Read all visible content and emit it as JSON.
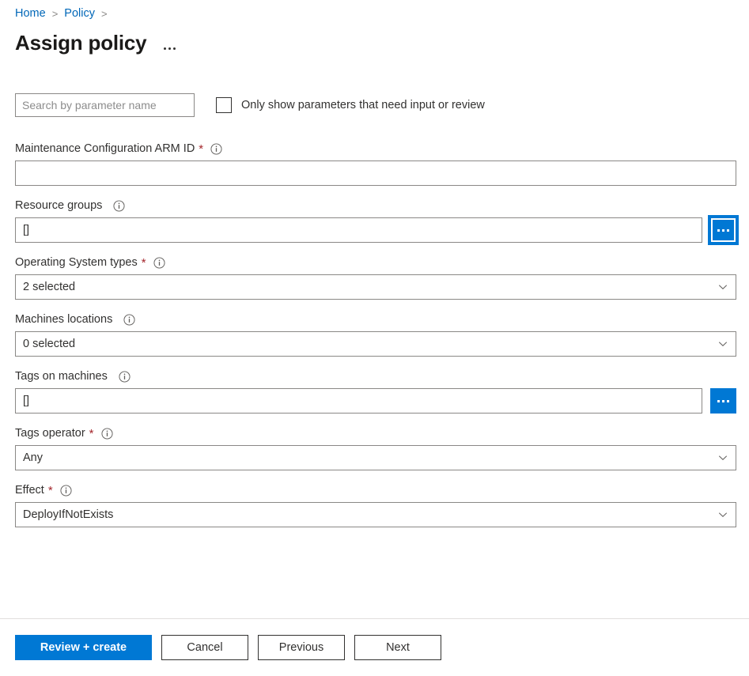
{
  "breadcrumb": {
    "items": [
      {
        "label": "Home"
      },
      {
        "label": "Policy"
      }
    ],
    "separator": ">"
  },
  "header": {
    "title": "Assign policy",
    "more_menu_name": "More commands"
  },
  "toolbar": {
    "search_placeholder": "Search by parameter name",
    "search_value": "",
    "checkbox_label": "Only show parameters that need input or review",
    "checkbox_checked": false
  },
  "form": {
    "fields": [
      {
        "label": "Maintenance Configuration ARM ID",
        "required_mark": "*",
        "value": "",
        "type": "text"
      },
      {
        "label": "Resource groups",
        "required_mark": "",
        "value": "[]",
        "type": "text-picker"
      },
      {
        "label": "Operating System types",
        "required_mark": "*",
        "value": "2 selected",
        "type": "select"
      },
      {
        "label": "Machines locations",
        "required_mark": "",
        "value": "0 selected",
        "type": "select"
      },
      {
        "label": "Tags on machines",
        "required_mark": "",
        "value": "[]",
        "type": "text-picker"
      },
      {
        "label": "Tags operator",
        "required_mark": "*",
        "value": "Any",
        "type": "select"
      },
      {
        "label": "Effect",
        "required_mark": "*",
        "value": "DeployIfNotExists",
        "type": "select"
      }
    ],
    "picker_button_label": "..."
  },
  "footer": {
    "review_create_label": "Review + create",
    "cancel_label": "Cancel",
    "previous_label": "Previous",
    "next_label": "Next"
  },
  "colors": {
    "accent": "#0078d4",
    "link": "#0067b8",
    "required": "#a4262c",
    "border": "#8a8886",
    "text": "#323130"
  }
}
